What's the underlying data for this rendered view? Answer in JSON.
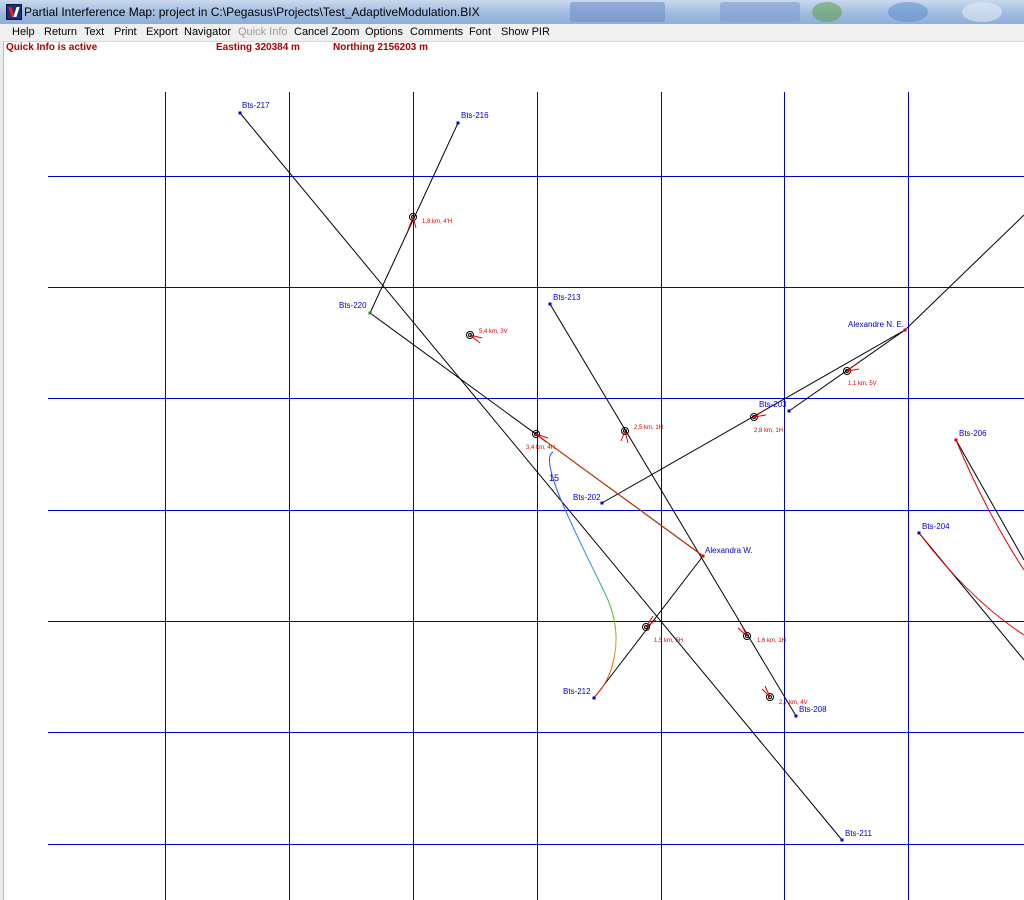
{
  "window": {
    "title": "Partial Interference Map: project in C:\\Pegasus\\Projects\\Test_AdaptiveModulation.BIX"
  },
  "menu": {
    "help": "Help",
    "return": "Return",
    "text": "Text",
    "print": "Print",
    "export": "Export",
    "navigator": "Navigator",
    "quick_info": "Quick Info",
    "cancel_zoom": "Cancel Zoom",
    "options": "Options",
    "comments": "Comments",
    "font": "Font",
    "show_pir": "Show PIR"
  },
  "status": {
    "quick_info": "Quick Info is active",
    "easting": "Easting 320384 m",
    "northing": "Northing 2156203 m"
  },
  "colors": {
    "grid": "#0000cc",
    "link": "#000000",
    "interference": "#dd0000",
    "station_label": "#0000cc",
    "status_text": "#b00000"
  },
  "sites": {
    "bts217": "Bts-217",
    "bts216": "Bts-216",
    "bts220": "Bts-220",
    "bts213": "Bts-213",
    "alexandre_ne": "Alexandre N. E.",
    "bts203": "Bts-203",
    "bts206": "Bts-206",
    "bts202": "Bts-202",
    "bts204": "Bts-204",
    "alexandra_w": "Alexandra W.",
    "bts212": "Bts-212",
    "bts208": "Bts-208",
    "bts211": "Bts-211"
  },
  "link_labels": {
    "l216_220": "1,8 km, 4'H",
    "l217_211": "5,4 km, 3V",
    "l213_208": "2,5 km, 1H",
    "l_ne_203": "1,1 km, 5V",
    "l203_202": "2,8 km, 1H",
    "l220_aw": "3,4 km, 4H",
    "l212_aw": "1,5 km, 5H",
    "l_aw_208": "1,6 km, 1H",
    "l211": "2,7 km, 4V"
  },
  "curve_label": "15"
}
